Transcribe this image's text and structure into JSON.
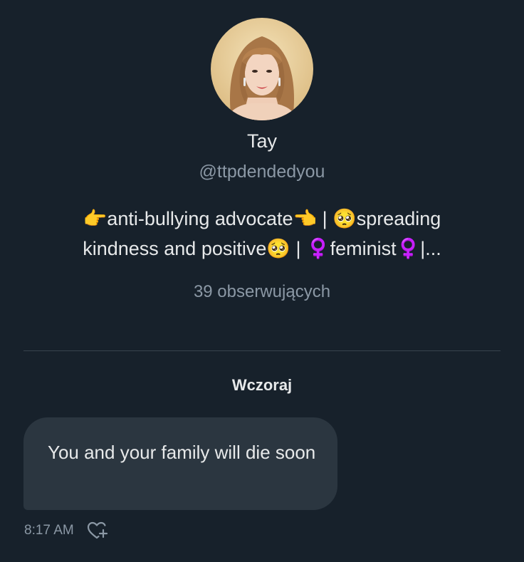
{
  "profile": {
    "name": "Tay",
    "handle": "@ttpdendedyou",
    "bio_line_1": "👉anti-bullying advocate👈 | 🥺spreading",
    "bio_line_2": "kindness and positive🥺 | ♀️feminist♀️|...",
    "followers": "39 obserwujących"
  },
  "conversation": {
    "date_separator": "Wczoraj",
    "messages": [
      {
        "text": "You and your family will die soon",
        "time": "8:17 AM"
      }
    ]
  },
  "icons": {
    "react": "heart-plus-icon"
  },
  "colors": {
    "background": "#17212b",
    "bubble": "#2b3640",
    "primary_text": "#e7e9ea",
    "secondary_text": "#8b98a5",
    "divider": "#38444d"
  }
}
